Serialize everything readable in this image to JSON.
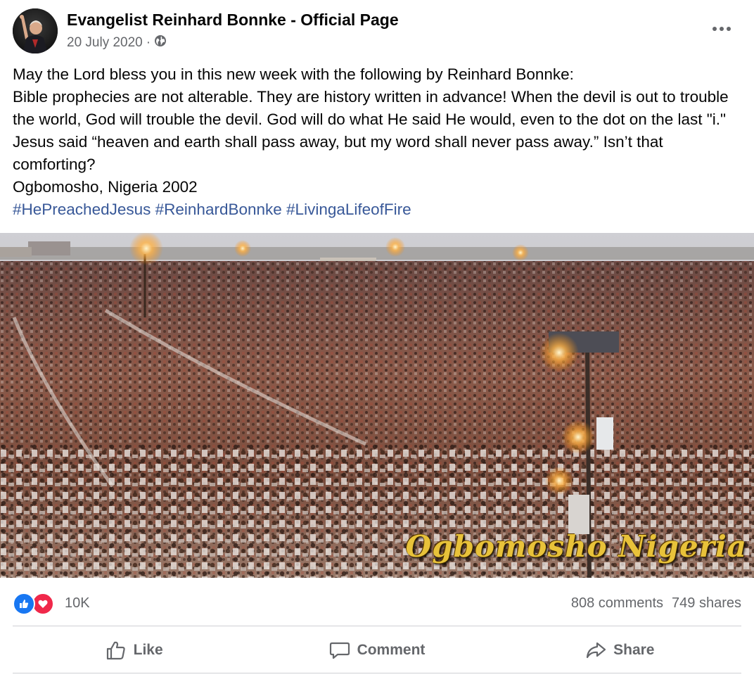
{
  "post": {
    "author": "Evangelist Reinhard Bonnke - Official Page",
    "date": "20 July 2020",
    "meta_separator": "·",
    "audience_icon": "globe-icon",
    "more_icon": "more-options-icon",
    "paragraphs": [
      "May the Lord bless you in this new week with the following by Reinhard Bonnke:",
      "Bible prophecies are not alterable. They are history written in advance! When the devil is out to trouble the world, God will trouble the devil. God will do what He said He would, even to the dot on the last \"i.\" Jesus said “heaven and earth shall pass away, but my word shall never pass away.” Isn’t that comforting?",
      "Ogbomosho, Nigeria 2002"
    ],
    "hashtags": [
      "#HePreachedJesus",
      "#ReinhardBonnke",
      "#LivingaLifeofFire"
    ],
    "photo_caption": "Ogbomosho Nigeria"
  },
  "stats": {
    "reaction_icons": [
      "like-reaction-icon",
      "love-reaction-icon"
    ],
    "reactions": "10K",
    "comments": "808 comments",
    "shares": "749 shares"
  },
  "actions": {
    "like_label": "Like",
    "comment_label": "Comment",
    "share_label": "Share"
  },
  "colors": {
    "link": "#385898",
    "secondary_text": "#65676b",
    "like_blue": "#1877f2",
    "love_red": "#f0284a",
    "caption_gold": "#e8c23a"
  }
}
